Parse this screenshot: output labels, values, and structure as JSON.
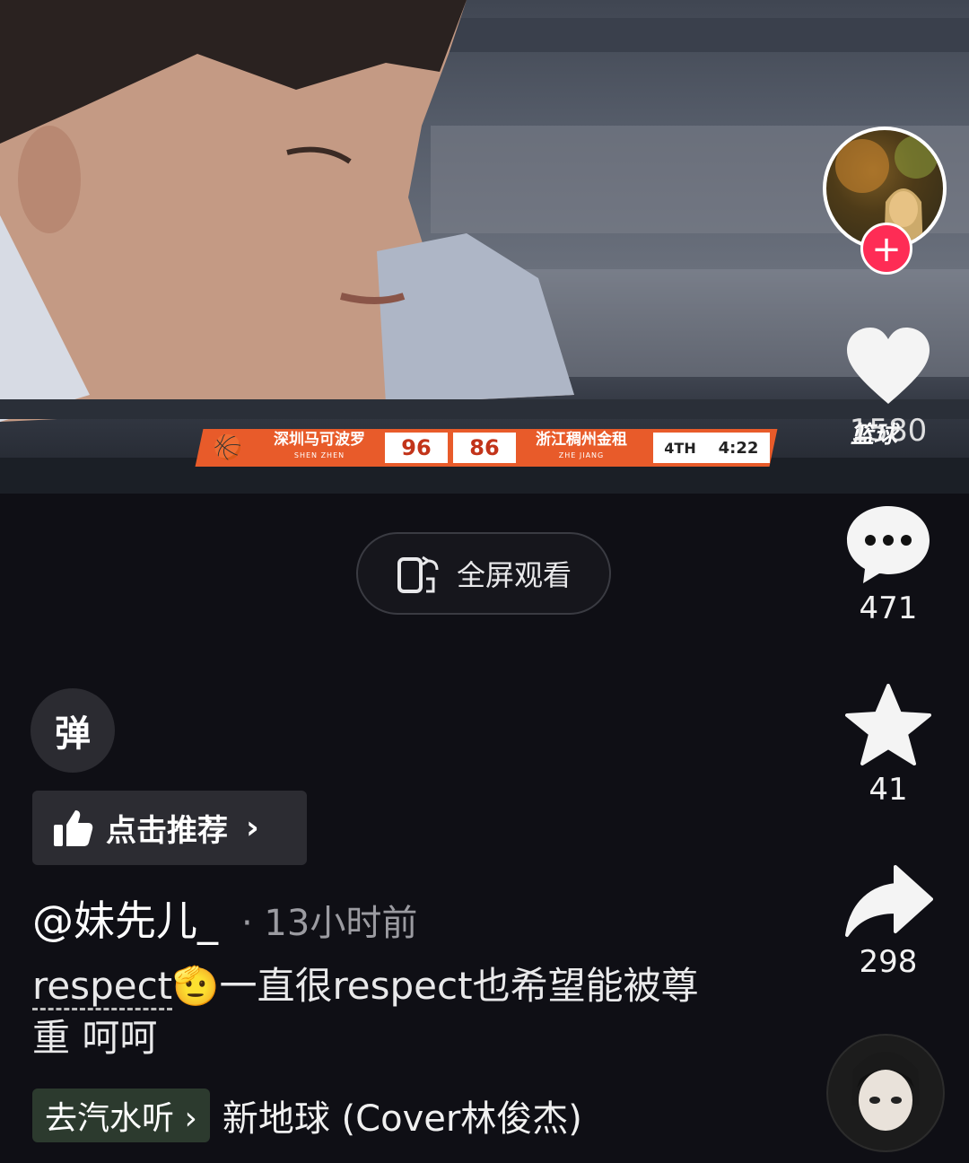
{
  "scoreboard": {
    "home_team": "深圳马可波罗",
    "home_team_en": "SHEN ZHEN",
    "home_score": "96",
    "away_score": "86",
    "away_team": "浙江稠州金租",
    "away_team_en": "ZHE JIANG",
    "period": "4TH",
    "clock": "4:22"
  },
  "video": {
    "watermark": "篮球"
  },
  "fullscreen": {
    "label": "全屏观看"
  },
  "actions": {
    "like_count": "1580",
    "comment_count": "471",
    "favorite_count": "41",
    "share_count": "298"
  },
  "danmu": {
    "label": "弹"
  },
  "recommend": {
    "label": "点击推荐"
  },
  "post": {
    "author": "@妹先儿_",
    "time": "· 13小时前",
    "caption_tag": "respect",
    "caption_emoji": "🫡",
    "caption_text": "一直很respect也希望能被尊重 呵呵"
  },
  "music": {
    "tag_label": "去汽水听 ›",
    "song": "新地球 (Cover林俊杰)"
  },
  "colors": {
    "follow_red": "#fe2c55",
    "score_orange": "#e85b2a"
  }
}
